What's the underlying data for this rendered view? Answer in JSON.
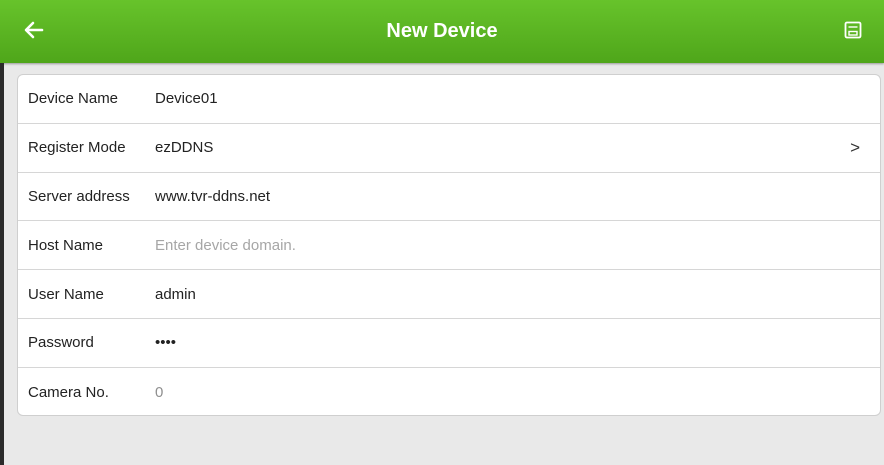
{
  "header": {
    "title": "New Device",
    "back_icon": "arrow-left-icon",
    "save_icon": "save-icon",
    "accent_color": "#5cb624"
  },
  "form": {
    "fields": [
      {
        "label": "Device Name",
        "value": "Device01",
        "placeholder": ""
      },
      {
        "label": "Register Mode",
        "value": "ezDDNS",
        "icon": "chevron-right-icon",
        "chevron": ">"
      },
      {
        "label": "Server address",
        "value": "www.tvr-ddns.net",
        "placeholder": ""
      },
      {
        "label": "Host Name",
        "value": "",
        "placeholder": "Enter device domain."
      },
      {
        "label": "User Name",
        "value": "admin",
        "placeholder": ""
      },
      {
        "label": "Password",
        "value": "••••",
        "placeholder": ""
      },
      {
        "label": "Camera No.",
        "value": "0",
        "placeholder": ""
      }
    ]
  }
}
